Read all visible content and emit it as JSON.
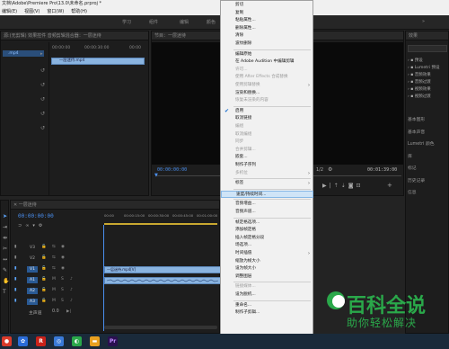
{
  "window": {
    "title": "文档\\Adobe\\Premiere Pro\\13.0\\未命名.prproj *"
  },
  "menubar": {
    "items": [
      "文件(F)",
      "编辑(E)",
      "剪辑(C)",
      "序列(S)",
      "标记(M)",
      "图形(G)",
      "视图(V)",
      "窗口(W)",
      "帮助(H)"
    ]
  },
  "workspaces": {
    "items": [
      "学习",
      "组件",
      "编辑",
      "颜色"
    ]
  },
  "source_panel": {
    "tabs": "源:(无剪辑)  效果控件  音频剪辑混合器：一层迷待",
    "clip_label": ".mp4",
    "tc_left": "00:00:00",
    "tc_mid": "00:00:30:00",
    "tc_right": "00:00",
    "clip_name": "一层迷待.mp4"
  },
  "program_panel": {
    "tab": "节目：一层迷待",
    "tc_current": "00:00:00:00",
    "zoom": "1/2",
    "tc_duration": "00:01:39:00"
  },
  "timeline": {
    "tab": "一层迷待",
    "timecode": "00:00:00:00",
    "ruler": [
      "00:00",
      "00:00:15:00",
      "00:00:30:00",
      "00:00:45:00",
      "00:01:00:00"
    ],
    "tracks": [
      {
        "label": "V3",
        "selected": false
      },
      {
        "label": "V2",
        "selected": false
      },
      {
        "label": "V1",
        "selected": true
      },
      {
        "label": "A1",
        "selected": true
      },
      {
        "label": "A2",
        "selected": true
      },
      {
        "label": "A3",
        "selected": true
      }
    ],
    "master": "主声道",
    "master_value": "0.0",
    "video_clip": "一层迷待.mp4[V]",
    "audio_clip": ""
  },
  "right_panel": {
    "header": "效果",
    "items": [
      "预设",
      "Lumetri 预设",
      "音频效果",
      "音频过渡",
      "视频效果",
      "视频过渡"
    ],
    "sections": [
      "基本图形",
      "基本声音",
      "Lumetri 颜色",
      "库",
      "标记",
      "历史记录",
      "信息"
    ]
  },
  "context_menu": {
    "items": [
      {
        "label": "剪切",
        "disabled": false
      },
      {
        "label": "复制",
        "disabled": false
      },
      {
        "label": "粘贴属性...",
        "disabled": false
      },
      {
        "label": "删除属性...",
        "disabled": false
      },
      {
        "label": "清除",
        "disabled": false
      },
      {
        "label": "波纹删除",
        "disabled": false
      },
      {
        "sep": true
      },
      {
        "label": "编辑原始",
        "disabled": false
      },
      {
        "label": "在 Adobe Audition 中编辑剪辑",
        "disabled": false
      },
      {
        "label": "许可...",
        "disabled": true
      },
      {
        "label": "使用 After Effects 合成替换",
        "disabled": true
      },
      {
        "label": "使用剪辑替换",
        "disabled": true,
        "submenu": true
      },
      {
        "label": "渲染和替换...",
        "disabled": false
      },
      {
        "label": "恢复未渲染的内容",
        "disabled": true
      },
      {
        "sep": true
      },
      {
        "label": "启用",
        "disabled": false,
        "checked": true
      },
      {
        "label": "取消链接",
        "disabled": false
      },
      {
        "label": "编组",
        "disabled": true
      },
      {
        "label": "取消编组",
        "disabled": true
      },
      {
        "label": "同步",
        "disabled": true
      },
      {
        "label": "合并剪辑...",
        "disabled": true
      },
      {
        "label": "嵌套...",
        "disabled": false
      },
      {
        "label": "制作子序列",
        "disabled": false
      },
      {
        "label": "多机位",
        "disabled": true,
        "submenu": true
      },
      {
        "sep": true
      },
      {
        "label": "标签",
        "disabled": false,
        "submenu": true
      },
      {
        "sep": true
      },
      {
        "label": "速度/持续时间...",
        "disabled": false,
        "highlighted": true
      },
      {
        "sep": true
      },
      {
        "label": "音频增益...",
        "disabled": false
      },
      {
        "label": "音频声道...",
        "disabled": false
      },
      {
        "sep": true
      },
      {
        "label": "帧定格选项...",
        "disabled": false
      },
      {
        "label": "添加帧定格",
        "disabled": false
      },
      {
        "label": "插入帧定格分段",
        "disabled": false
      },
      {
        "label": "场选项...",
        "disabled": false
      },
      {
        "label": "时间插值",
        "disabled": false,
        "submenu": true
      },
      {
        "label": "缩放为帧大小",
        "disabled": false
      },
      {
        "label": "设为帧大小",
        "disabled": false
      },
      {
        "label": "调整图层",
        "disabled": false
      },
      {
        "sep": true
      },
      {
        "label": "链接媒体...",
        "disabled": true
      },
      {
        "label": "设为脱机...",
        "disabled": false
      },
      {
        "sep": true
      },
      {
        "label": "重命名...",
        "disabled": false
      },
      {
        "label": "制作子剪辑...",
        "disabled": false
      }
    ]
  },
  "watermark": {
    "title": "百科全说",
    "subtitle": "助你轻松解决"
  },
  "taskbar": {
    "icons": [
      "edge-icon",
      "baidu-icon",
      "r-app-icon",
      "chrome-icon",
      "wechat-icon",
      "folder-icon",
      "premiere-icon"
    ]
  }
}
